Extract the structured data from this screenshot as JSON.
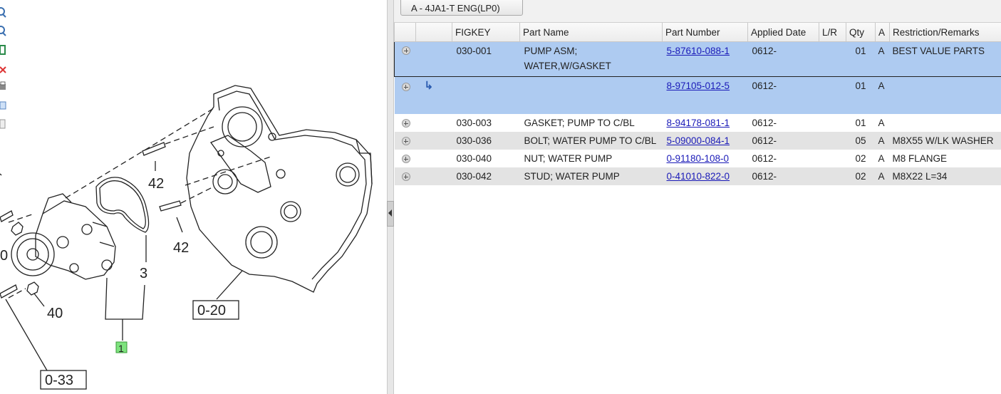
{
  "diagram": {
    "callouts": [
      "42",
      "42",
      "3",
      "40",
      "0",
      "0-20",
      "1",
      "0-33"
    ]
  },
  "tab": {
    "label": "A - 4JA1-T ENG(LP0)"
  },
  "table": {
    "headers": [
      "",
      "",
      "FIGKEY",
      "Part Name",
      "Part Number",
      "Applied Date",
      "L/R",
      "Qty",
      "A",
      "Restriction/Remarks"
    ],
    "rows": [
      {
        "figkey": "030-001",
        "name_line1": "PUMP ASM;",
        "name_line2": "WATER,W/GASKET",
        "part_number": "5-87610-088-1",
        "applied_date": "0612-",
        "lr": "",
        "qty": "01",
        "a": "A",
        "remarks": "BEST VALUE PARTS"
      },
      {
        "figkey": "",
        "name": "",
        "part_number": "8-97105-012-5",
        "applied_date": "0612-",
        "lr": "",
        "qty": "01",
        "a": "A",
        "remarks": ""
      },
      {
        "figkey": "030-003",
        "name": "GASKET; PUMP TO C/BL",
        "part_number": "8-94178-081-1",
        "applied_date": "0612-",
        "lr": "",
        "qty": "01",
        "a": "A",
        "remarks": ""
      },
      {
        "figkey": "030-036",
        "name": "BOLT; WATER PUMP TO C/BL",
        "part_number": "5-09000-084-1",
        "applied_date": "0612-",
        "lr": "",
        "qty": "05",
        "a": "A",
        "remarks": "M8X55 W/LK WASHER"
      },
      {
        "figkey": "030-040",
        "name": "NUT; WATER PUMP",
        "part_number": "0-91180-108-0",
        "applied_date": "0612-",
        "lr": "",
        "qty": "02",
        "a": "A",
        "remarks": "M8 FLANGE"
      },
      {
        "figkey": "030-042",
        "name": "STUD; WATER PUMP",
        "part_number": "0-41010-822-0",
        "applied_date": "0612-",
        "lr": "",
        "qty": "02",
        "a": "A",
        "remarks": "M8X22 L=34"
      }
    ]
  },
  "colors": {
    "selected_row": "#aecbf1",
    "alt_row": "#e3e3e3",
    "link": "#1a1ab8",
    "callout_highlight": "#7ee37e"
  }
}
